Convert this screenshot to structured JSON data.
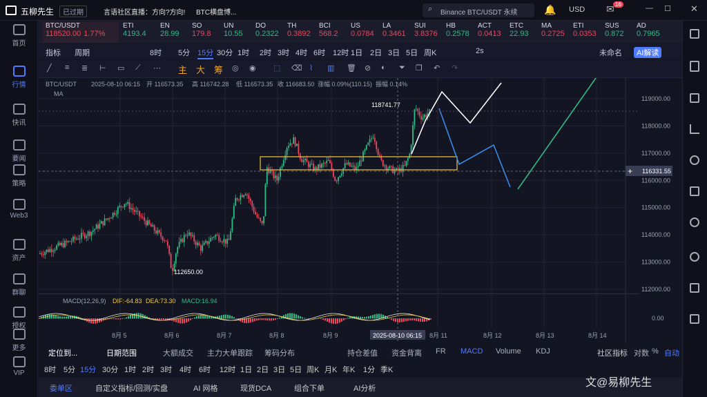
{
  "app": {
    "title": "五柳先生",
    "status": "已过期",
    "marquee": "言语社区直播：方向?方向!",
    "marquee2": "BTC横盘博..."
  },
  "search": {
    "placeholder": "Binance BTC/USDT 永续"
  },
  "currency": "USD",
  "notif_count": "16",
  "nav": [
    "首页",
    "行情",
    "快讯",
    "要闻",
    "策略",
    "Web3",
    "资产",
    "群聊",
    "授权",
    "更多",
    "VIP"
  ],
  "ticker": [
    {
      "s": "BTC/USDT",
      "p": "118520.00",
      "c": "1.77%"
    },
    {
      "s": "ETI",
      "p": "4193.4"
    },
    {
      "s": "EN",
      "p": "28.99"
    },
    {
      "s": "SO",
      "p": "179.8"
    },
    {
      "s": "UN",
      "p": "10.55"
    },
    {
      "s": "DO",
      "p": "0.2322"
    },
    {
      "s": "TH",
      "p": "0.3892"
    },
    {
      "s": "BCI",
      "p": "568.2"
    },
    {
      "s": "US",
      "p": "0.0784"
    },
    {
      "s": "LA",
      "p": "0.3461"
    },
    {
      "s": "SUI",
      "p": "3.8376"
    },
    {
      "s": "HB",
      "p": "0.2578"
    },
    {
      "s": "ACT",
      "p": "0.0413"
    },
    {
      "s": "ETC",
      "p": "22.93"
    },
    {
      "s": "MA",
      "p": "0.2725"
    },
    {
      "s": "ETI",
      "p": "0.0353"
    },
    {
      "s": "SUS",
      "p": "0.872"
    },
    {
      "s": "AD",
      "p": "0.7965"
    }
  ],
  "toolbar": [
    "指标",
    "周期",
    "8时",
    "5分",
    "15分",
    "30分",
    "1时",
    "2时",
    "3时",
    "4时",
    "6时",
    "12时",
    "1日",
    "2日",
    "3日",
    "5日",
    "周K",
    "2s",
    "未命名",
    "AI解读"
  ],
  "drawtools": [
    "主",
    "大",
    "筹"
  ],
  "ohlc": {
    "pair": "BTC/USDT",
    "time": "2025-08-10 06:15",
    "open": "开 116573.35",
    "high": "高 116742.28",
    "low": "低 116573.35",
    "close": "收 116683.50",
    "chg": "涨幅 0.09%(110.15)",
    "amp": "振幅 0.14%",
    "ma": "MA"
  },
  "chart_data": {
    "type": "candlestick",
    "high_label": "118741.77",
    "low_label": "112650.00",
    "current": "116331.55",
    "y_ticks": [
      "119000.00",
      "118000.00",
      "117000.00",
      "116000.00",
      "115000.00",
      "114000.00",
      "113000.00",
      "112000.00"
    ],
    "x_ticks": [
      "8月 5",
      "8月 6",
      "8月 7",
      "8月 8",
      "8月 9",
      "8月 11",
      "8月 12",
      "8月 13",
      "8月 14"
    ],
    "crosshair_time": "2025-08-10 06:15"
  },
  "macd": {
    "label": "MACD(12,26,9)",
    "dif": "DIF:-64.83",
    "dea": "DEA:73.30",
    "macd": "MACD:16.94",
    "zero": "0.00"
  },
  "bottom": {
    "locate": "定位到...",
    "range": "日期范围",
    "tabs": [
      "大额成交",
      "主力大单跟踪",
      "筹码分布",
      "持仓差值",
      "资金背离",
      "FR",
      "MACD",
      "Volume",
      "KDJ"
    ],
    "community": "社区指标",
    "log": "对数",
    "pct": "%",
    "auto": "自动",
    "periods": [
      "8时",
      "5分",
      "15分",
      "30分",
      "1时",
      "2时",
      "3时",
      "4时",
      "6时",
      "12时",
      "1日",
      "2日",
      "3日",
      "5日",
      "周K",
      "月K",
      "年K",
      "1分",
      "季K"
    ],
    "panel": [
      "委单区",
      "自定义指标/回测/实盘",
      "AI 网格",
      "现货DCA",
      "组合下单",
      "AI分析"
    ],
    "watermark": "文@易柳先生"
  },
  "colors": {
    "up": "#2ebd85",
    "down": "#f0475c",
    "accent": "#4f7cff"
  }
}
